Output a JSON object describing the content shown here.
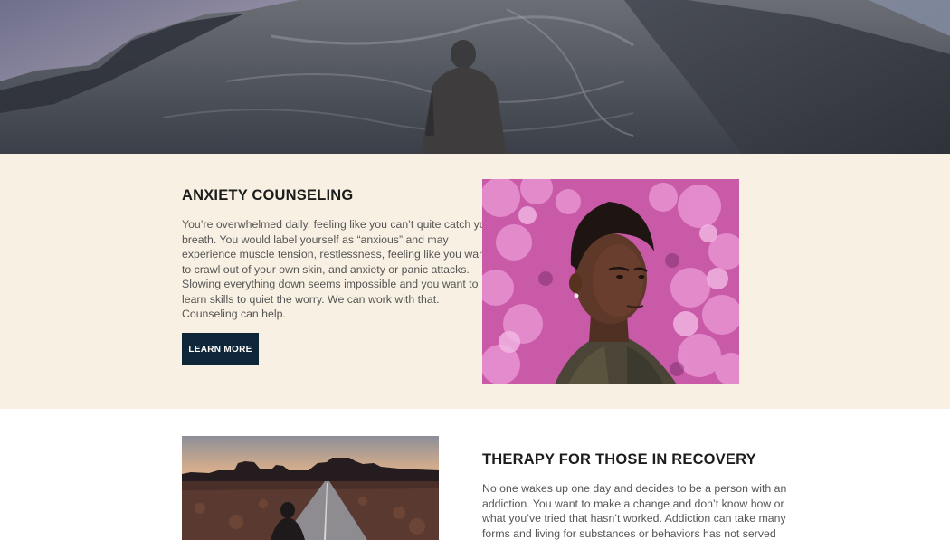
{
  "hero": {
    "image": "mountain-hiker-photo"
  },
  "anxiety": {
    "title": "ANXIETY COUNSELING",
    "body_lines": [
      "You’re overwhelmed daily, feeling like you can’t quite catch your",
      "breath. You would label yourself as “anxious” and may",
      "experience muscle tension, restlessness, feeling like you want",
      "to crawl out of your own skin, and anxiety or panic attacks.",
      "Slowing everything down seems impossible and you want to",
      "learn skills to quiet the worry. We can work with that.",
      "Counseling can help."
    ],
    "button_label": "LEARN MORE",
    "image": "man-in-flowers-photo"
  },
  "recovery": {
    "title": "THERAPY FOR THOSE IN RECOVERY",
    "body_lines": [
      "No one wakes up one day and decides to be a person with an",
      "addiction. You want to make a change and don’t know how or",
      "what you’ve tried that hasn’t worked. Addiction can take many",
      "forms and living for substances or behaviors has not served"
    ],
    "image": "desert-road-photo"
  },
  "colors": {
    "cream_band": "#f8f1e3",
    "button_bg": "#0f2538",
    "heading": "#1c1c1c",
    "body_text": "#555555"
  }
}
